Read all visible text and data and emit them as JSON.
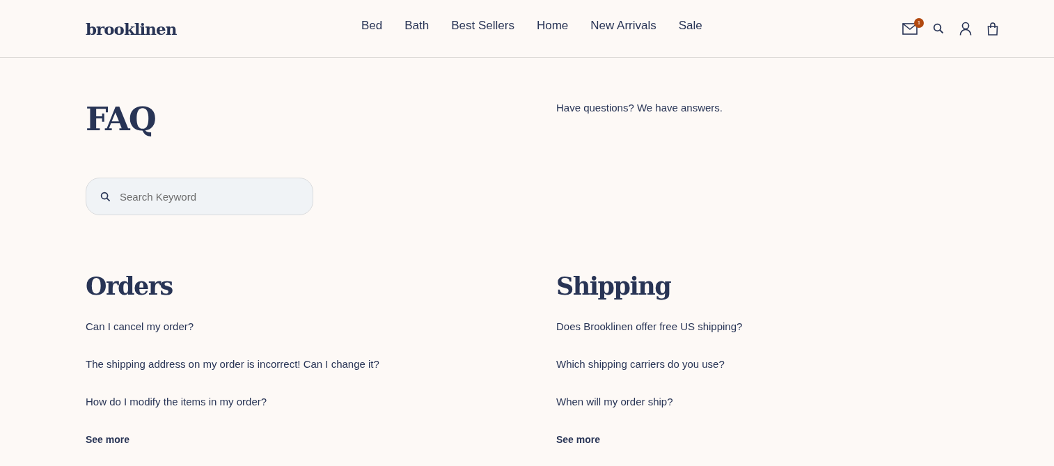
{
  "header": {
    "logo": "brooklinen",
    "nav": [
      "Bed",
      "Bath",
      "Best Sellers",
      "Home",
      "New Arrivals",
      "Sale"
    ],
    "mail_badge": "1"
  },
  "intro": {
    "title": "FAQ",
    "subtitle": "Have questions? We have answers.",
    "search": {
      "placeholder": "Search Keyword"
    }
  },
  "sections": [
    {
      "title": "Orders",
      "questions": [
        "Can I cancel my order?",
        "The shipping address on my order is incorrect! Can I change it?",
        "How do I modify the items in my order?"
      ],
      "more": "See more"
    },
    {
      "title": "Shipping",
      "questions": [
        "Does Brooklinen offer free US shipping?",
        "Which shipping carriers do you use?",
        "When will my order ship?"
      ],
      "more": "See more"
    }
  ]
}
